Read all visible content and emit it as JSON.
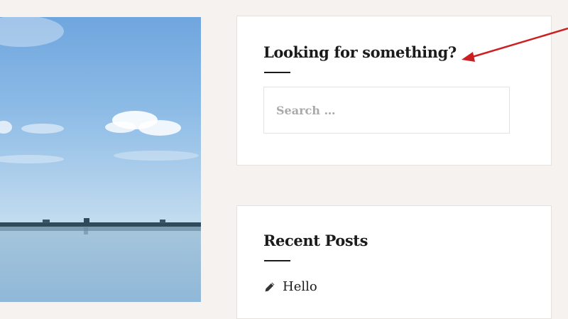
{
  "search_widget": {
    "title": "Looking for something?",
    "placeholder": "Search …"
  },
  "recent_posts_widget": {
    "title": "Recent Posts",
    "posts": [
      {
        "label": "Hello",
        "icon": "pencil-icon"
      }
    ]
  },
  "colors": {
    "page_background": "#f6f2ef",
    "widget_background": "#ffffff",
    "title_text": "#1b1b1b",
    "annotation_arrow": "#cc1f1f"
  }
}
